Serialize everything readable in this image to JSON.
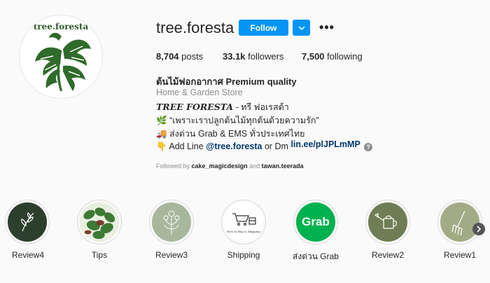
{
  "profile": {
    "avatar_text": "tree.foresta",
    "username": "tree.foresta",
    "follow_label": "Follow",
    "more_label": "•••"
  },
  "stats": {
    "posts": "8,704",
    "posts_label": "posts",
    "followers": "33.1k",
    "followers_label": "followers",
    "following": "7,500",
    "following_label": "following"
  },
  "bio": {
    "name": "ต้นไม้ฟอกอากาศ Premium quality",
    "category": "Home & Garden Store",
    "brand": "TREE FORESTA",
    "brand_suffix": " - ทรี ฟอเรสต้า",
    "line1_icon": "🌿",
    "line1_text": " “เพราะเราปลูกต้นไม้ทุกต้นด้วยความรัก”",
    "line2_icon": "🚚",
    "line2_text": " ส่งด่วน Grab & EMS ทั่วประเทศไทย",
    "line3_icon": "👇",
    "line3_text": " Add Line ",
    "line3_mention": "@tree.foresta",
    "line3_mid": " or Dm ",
    "link": "lin.ee/plJPLmMP",
    "help_glyph": "?"
  },
  "followed_by": {
    "prefix": "Followed by ",
    "user1": "cake_magicdesign",
    "and": " and ",
    "user2": "tawan.teerada"
  },
  "highlights": [
    {
      "label": "Review4",
      "color": "#2c3f2d"
    },
    {
      "label": "Tips",
      "color": "#d9e6cf"
    },
    {
      "label": "Review3",
      "color": "#a8b79c"
    },
    {
      "label": "Shipping",
      "color": "#ffffff",
      "inner_text": "How to Buy & Shipping"
    },
    {
      "label": "ส่งด่วน Grab",
      "color": "#00b14f",
      "inner_text": "Grab"
    },
    {
      "label": "Review2",
      "color": "#6f7d55"
    },
    {
      "label": "Review1",
      "color": "#a3ab86"
    }
  ],
  "colors": {
    "accent": "#0095f6",
    "link": "#00376b",
    "muted": "#8e8e8e"
  }
}
